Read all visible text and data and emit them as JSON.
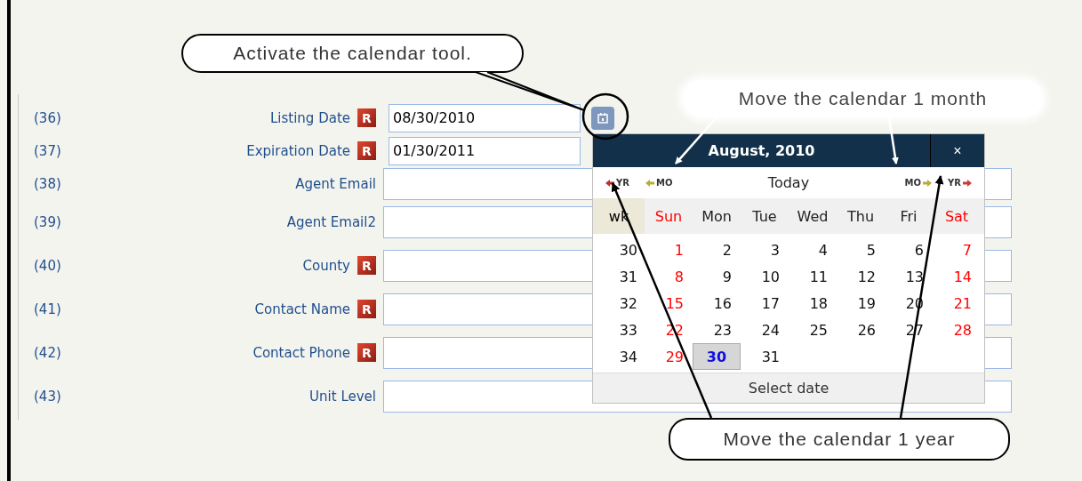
{
  "fields": [
    {
      "number": "(36)",
      "label": "Listing Date",
      "required": true,
      "badge": "R",
      "value": "08/30/2010",
      "kind": "date"
    },
    {
      "number": "(37)",
      "label": "Expiration Date",
      "required": true,
      "badge": "R",
      "value": "01/30/2011",
      "kind": "date-plain"
    },
    {
      "number": "(38)",
      "label": "Agent Email",
      "required": false,
      "kind": "text"
    },
    {
      "number": "(39)",
      "label": "Agent Email2",
      "required": false,
      "kind": "text"
    },
    {
      "number": "(40)",
      "label": "County",
      "required": true,
      "badge": "R",
      "kind": "text"
    },
    {
      "number": "(41)",
      "label": "Contact Name",
      "required": true,
      "badge": "R",
      "kind": "text"
    },
    {
      "number": "(42)",
      "label": "Contact Phone",
      "required": true,
      "badge": "R",
      "kind": "text"
    },
    {
      "number": "(43)",
      "label": "Unit Level",
      "required": false,
      "kind": "text"
    }
  ],
  "calendar": {
    "title": "August, 2010",
    "close": "×",
    "nav": {
      "prev_year": "YR",
      "prev_month": "MO",
      "today": "Today",
      "next_month": "MO",
      "next_year": "YR"
    },
    "week_header": "wk",
    "weekdays": [
      {
        "label": "Sun",
        "weekend": true
      },
      {
        "label": "Mon",
        "weekend": false
      },
      {
        "label": "Tue",
        "weekend": false
      },
      {
        "label": "Wed",
        "weekend": false
      },
      {
        "label": "Thu",
        "weekend": false
      },
      {
        "label": "Fri",
        "weekend": false
      },
      {
        "label": "Sat",
        "weekend": true
      }
    ],
    "weeks": [
      {
        "week": "30",
        "days": [
          {
            "day": "1",
            "selected": false
          },
          {
            "day": "2",
            "selected": false
          },
          {
            "day": "3",
            "selected": false
          },
          {
            "day": "4",
            "selected": false
          },
          {
            "day": "5",
            "selected": false
          },
          {
            "day": "6",
            "selected": false
          },
          {
            "day": "7",
            "selected": false
          }
        ]
      },
      {
        "week": "31",
        "days": [
          {
            "day": "8",
            "selected": false
          },
          {
            "day": "9",
            "selected": false
          },
          {
            "day": "10",
            "selected": false
          },
          {
            "day": "11",
            "selected": false
          },
          {
            "day": "12",
            "selected": false
          },
          {
            "day": "13",
            "selected": false
          },
          {
            "day": "14",
            "selected": false
          }
        ]
      },
      {
        "week": "32",
        "days": [
          {
            "day": "15",
            "selected": false
          },
          {
            "day": "16",
            "selected": false
          },
          {
            "day": "17",
            "selected": false
          },
          {
            "day": "18",
            "selected": false
          },
          {
            "day": "19",
            "selected": false
          },
          {
            "day": "20",
            "selected": false
          },
          {
            "day": "21",
            "selected": false
          }
        ]
      },
      {
        "week": "33",
        "days": [
          {
            "day": "22",
            "selected": false
          },
          {
            "day": "23",
            "selected": false
          },
          {
            "day": "24",
            "selected": false
          },
          {
            "day": "25",
            "selected": false
          },
          {
            "day": "26",
            "selected": false
          },
          {
            "day": "27",
            "selected": false
          },
          {
            "day": "28",
            "selected": false
          }
        ]
      },
      {
        "week": "34",
        "days": [
          {
            "day": "29",
            "selected": false
          },
          {
            "day": "30",
            "selected": true
          },
          {
            "day": "31",
            "selected": false
          }
        ]
      }
    ],
    "footer": "Select date"
  },
  "callouts": [
    {
      "kind": "oval",
      "text": "Activate the calendar tool."
    },
    {
      "kind": "cloud",
      "text": "Move the calendar 1 month"
    },
    {
      "kind": "oval",
      "text": "Move the calendar 1 year"
    }
  ]
}
